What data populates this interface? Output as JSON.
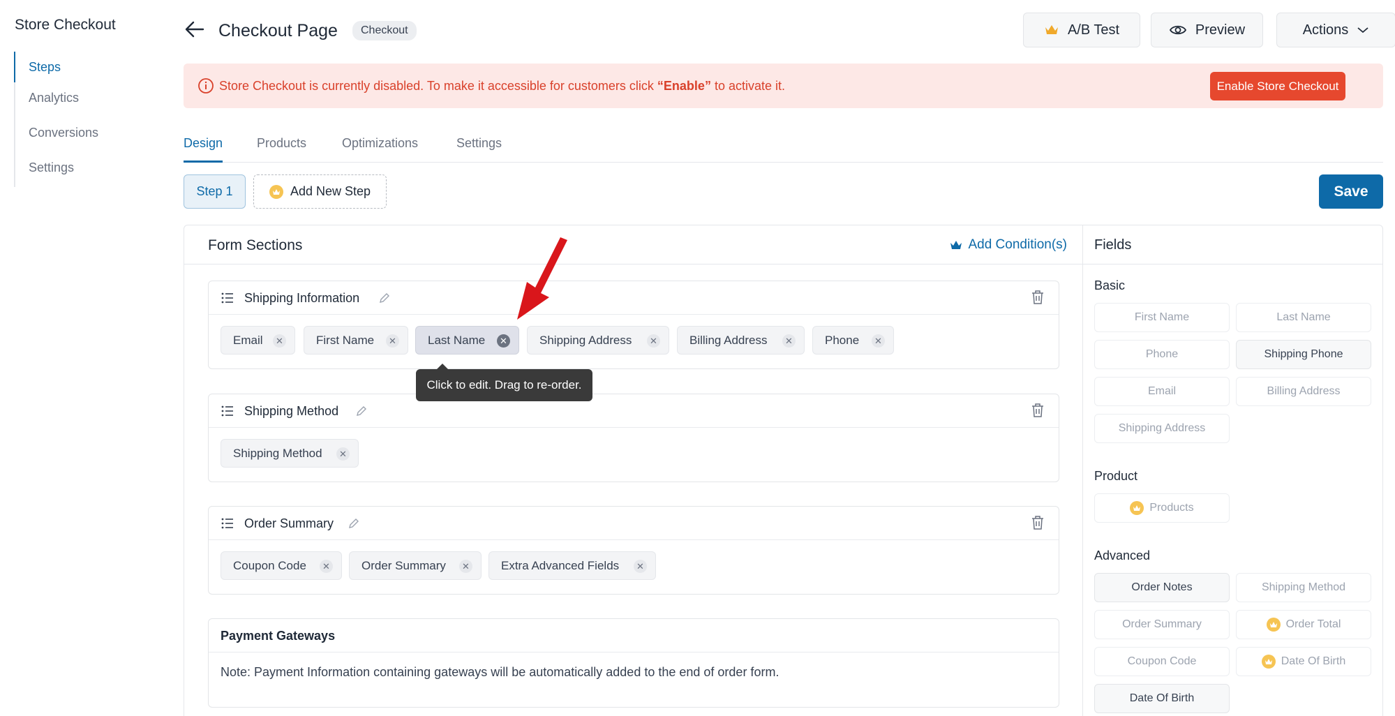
{
  "sidebar": {
    "title": "Store Checkout",
    "items": [
      {
        "label": "Steps",
        "active": true
      },
      {
        "label": "Analytics"
      },
      {
        "label": "Conversions"
      },
      {
        "label": "Settings"
      }
    ]
  },
  "header": {
    "title": "Checkout Page",
    "badge": "Checkout",
    "ab_test": "A/B Test",
    "preview": "Preview",
    "actions": "Actions"
  },
  "alert": {
    "text_before": "Store Checkout is currently disabled. To make it accessible for customers click ",
    "highlight": "“Enable”",
    "text_after": " to activate it.",
    "button": "Enable Store Checkout"
  },
  "tabs": [
    {
      "label": "Design",
      "active": true
    },
    {
      "label": "Products"
    },
    {
      "label": "Optimizations"
    },
    {
      "label": "Settings"
    }
  ],
  "steps": {
    "step1": "Step 1",
    "add_new": "Add New Step",
    "save": "Save"
  },
  "form": {
    "title": "Form Sections",
    "add_condition": "Add Condition(s)",
    "sections": [
      {
        "title": "Shipping Information",
        "chips": [
          "Email",
          "First Name",
          "Last Name",
          "Shipping Address",
          "Billing Address",
          "Phone"
        ]
      },
      {
        "title": "Shipping Method",
        "chips": [
          "Shipping Method"
        ]
      },
      {
        "title": "Order Summary",
        "chips": [
          "Coupon Code",
          "Order Summary",
          "Extra Advanced Fields"
        ]
      }
    ],
    "tooltip": "Click to edit. Drag to re-order.",
    "payment": {
      "title": "Payment Gateways",
      "note": "Note: Payment Information containing gateways will be automatically added to the end of order form."
    }
  },
  "fields": {
    "title": "Fields",
    "groups": {
      "basic": {
        "title": "Basic",
        "items": [
          "First Name",
          "Last Name",
          "Phone",
          "Shipping Phone",
          "Email",
          "Billing Address",
          "Shipping Address"
        ]
      },
      "product": {
        "title": "Product",
        "items": [
          "Products"
        ]
      },
      "advanced": {
        "title": "Advanced",
        "items": [
          "Order Notes",
          "Shipping Method",
          "Order Summary",
          "Order Total",
          "Coupon Code",
          "Date Of Birth",
          "Date Of Birth"
        ]
      }
    }
  },
  "colors": {
    "accent": "#0e6aa8",
    "danger": "#e6482e",
    "alert_bg": "#fde8e6",
    "pro_badge": "#f6c453"
  }
}
